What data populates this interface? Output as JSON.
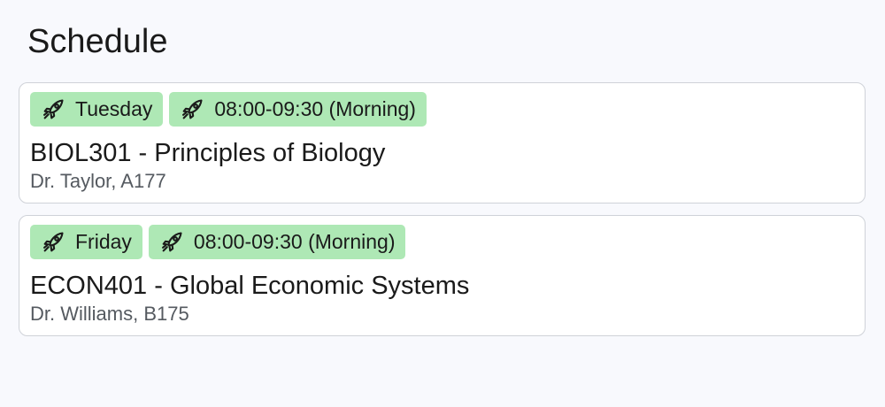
{
  "page": {
    "title": "Schedule"
  },
  "colors": {
    "tag_background": "#aee8b5",
    "card_border": "#cfd2d8",
    "page_background": "#f8f9fd"
  },
  "icons": {
    "tag_icon": "rocket-icon"
  },
  "courses": [
    {
      "day": "Tuesday",
      "time": "08:00-09:30 (Morning)",
      "title": "BIOL301 - Principles of Biology",
      "details": "Dr. Taylor, A177"
    },
    {
      "day": "Friday",
      "time": "08:00-09:30 (Morning)",
      "title": "ECON401 - Global Economic Systems",
      "details": "Dr. Williams, B175"
    }
  ]
}
